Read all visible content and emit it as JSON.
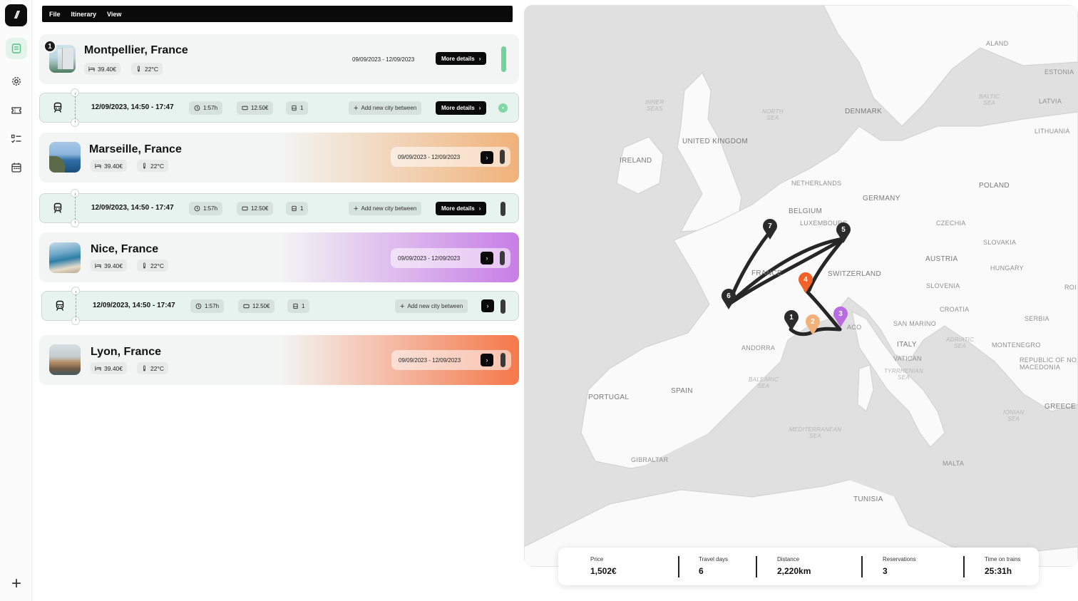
{
  "menubar": {
    "items": [
      "File",
      "Itinerary",
      "View"
    ]
  },
  "sidebar": {
    "logo": "//",
    "items": [
      {
        "name": "itinerary-nav",
        "icon": "document-icon",
        "active": true
      },
      {
        "name": "settings-nav",
        "icon": "gear-icon",
        "active": false
      },
      {
        "name": "tickets-nav",
        "icon": "ticket-icon",
        "active": false
      },
      {
        "name": "checklist-nav",
        "icon": "checklist-icon",
        "active": false
      },
      {
        "name": "calendar-nav",
        "icon": "calendar-icon",
        "active": false
      }
    ],
    "add_label": "+"
  },
  "cities": [
    {
      "index": "1",
      "name": "Montpellier, France",
      "price": "39.40€",
      "temp": "22°C",
      "dates": "09/09/2023 - 12/09/2023",
      "details_label": "More details",
      "accent": "#6fd39a"
    },
    {
      "name": "Marseille, France",
      "price": "39.40€",
      "temp": "22°C",
      "dates": "09/09/2023 - 12/09/2023",
      "accent": "#f0b27a"
    },
    {
      "name": "Nice, France",
      "price": "39.40€",
      "temp": "22°C",
      "dates": "09/09/2023 - 12/09/2023",
      "accent": "#c77ee6"
    },
    {
      "name": "Lyon, France",
      "price": "39.40€",
      "temp": "22°C",
      "dates": "09/09/2023 - 12/09/2023",
      "accent": "#f5784a"
    }
  ],
  "trains": [
    {
      "time": "12/09/2023, 14:50 - 17:47",
      "duration": "1:57h",
      "price": "12.50€",
      "seats": "1",
      "add_label": "Add new city between",
      "details_label": "More details"
    },
    {
      "time": "12/09/2023, 14:50 - 17:47",
      "duration": "1:57h",
      "price": "12.50€",
      "seats": "1",
      "add_label": "Add new city between",
      "details_label": "More details"
    },
    {
      "time": "12/09/2023, 14:50 - 17:47",
      "duration": "1:57h",
      "price": "12.50€",
      "seats": "1",
      "add_label": "Add new city between"
    }
  ],
  "map": {
    "labels": {
      "aland": "ALAND",
      "estonia": "ESTONIA",
      "latvia": "LATVIA",
      "lithuania": "LITHUANIA",
      "denmark": "DENMARK",
      "uk": "UNITED KINGDOM",
      "ireland": "IRELAND",
      "netherlands": "NETHERLANDS",
      "germany": "GERMANY",
      "poland": "POLAND",
      "belgium": "BELGIUM",
      "luxembourg": "LUXEMBOURG",
      "czechia": "CZECHIA",
      "slovakia": "SLOVAKIA",
      "austria": "AUSTRIA",
      "hungary": "HUNGARY",
      "france": "FRANCE",
      "switzerland": "SWITZERLAND",
      "slovenia": "SLOVENIA",
      "croatia": "CROATIA",
      "ro": "ROI",
      "serbia": "SERBIA",
      "sanmarino": "SAN MARINO",
      "monaco": "ACO",
      "andorra": "ANDORRA",
      "italy": "ITALY",
      "montenegro": "MONTENEGRO",
      "vatican": "VATICAN",
      "macedonia": "REPUBLIC OF NO\nMACEDONIA",
      "greece": "GREECE",
      "portugal": "PORTUGAL",
      "spain": "SPAIN",
      "gibraltar": "GIBRALTAR",
      "malta": "MALTA",
      "tunisia": "TUNISIA",
      "innerseas": "INNER\nSEAS",
      "northsea": "NORTH\nSEA",
      "balticsea": "BALTIC\nSEA",
      "adriaticsea": "ADRIATIC\nSEA",
      "balearicsea": "BALEARIC\nSEA",
      "tyrrhenian": "TYRRHENIAN\nSEA",
      "ionian": "IONIAN\nSEA",
      "mediterranean": "MEDITERRANEAN\nSEA"
    },
    "pins": [
      {
        "label": "1",
        "color": "#2b2b2b"
      },
      {
        "label": "2",
        "color": "#f0b27a"
      },
      {
        "label": "3",
        "color": "#b86ce0"
      },
      {
        "label": "4",
        "color": "#f0622a"
      },
      {
        "label": "5",
        "color": "#2b2b2b"
      },
      {
        "label": "6",
        "color": "#2b2b2b"
      },
      {
        "label": "7",
        "color": "#2b2b2b"
      }
    ]
  },
  "stats": [
    {
      "label": "Price",
      "value": "1,502€"
    },
    {
      "label": "Travel days",
      "value": "6"
    },
    {
      "label": "Distance",
      "value": "2,220km"
    },
    {
      "label": "Reservations",
      "value": "3"
    },
    {
      "label": "Time on trains",
      "value": "25:31h"
    }
  ]
}
